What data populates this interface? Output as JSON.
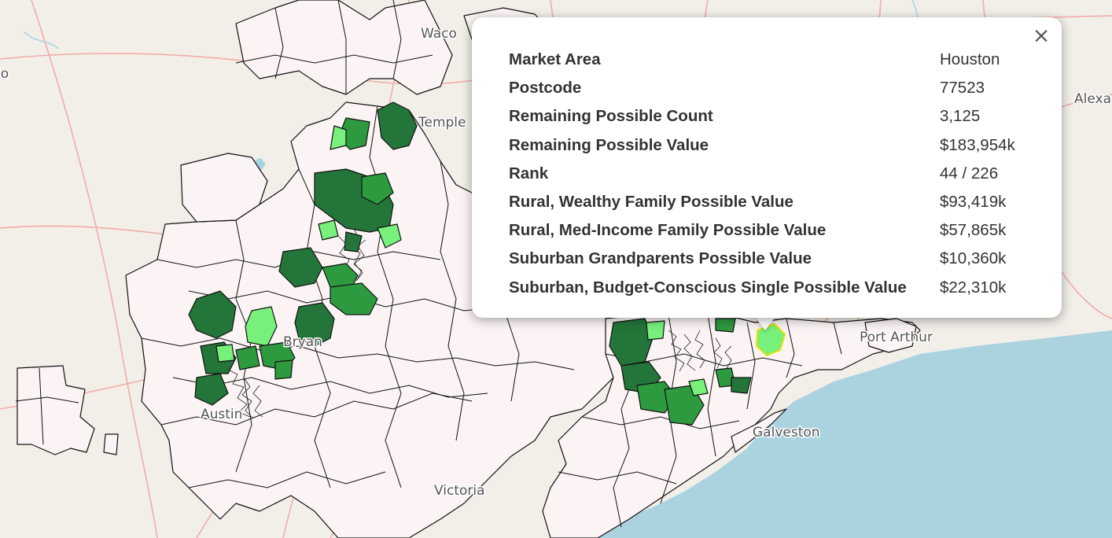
{
  "map": {
    "cities": [
      {
        "id": "temple",
        "name": "Temple"
      },
      {
        "id": "alexandria",
        "name": "Alexa"
      },
      {
        "id": "port-arthur",
        "name": "Port Arthur"
      },
      {
        "id": "galveston",
        "name": "Galveston"
      },
      {
        "id": "victoria",
        "name": "Victoria"
      },
      {
        "id": "bryan",
        "name": "Bryan"
      },
      {
        "id": "left-edge",
        "name": "lo"
      },
      {
        "id": "waco",
        "name": "Waco"
      },
      {
        "id": "austin",
        "name": "Austin"
      }
    ],
    "colors": {
      "water": "#aad3df",
      "land": "#f2efe9",
      "zone_base": "#fcf4f4",
      "zone_dark": "#23753a",
      "zone_mid": "#2e9a40",
      "zone_light": "#78f07c",
      "road": "#f2a4a0",
      "selected": "#e6e100"
    }
  },
  "popup": {
    "close_label": "×",
    "rows": [
      {
        "label": "Market Area",
        "value": "Houston"
      },
      {
        "label": "Postcode",
        "value": "77523"
      },
      {
        "label": "Remaining Possible Count",
        "value": "3,125"
      },
      {
        "label": "Remaining Possible Value",
        "value": "$183,954k"
      },
      {
        "label": "Rank",
        "value": "44 / 226"
      },
      {
        "label": "Rural, Wealthy Family Possible Value",
        "value": "$93,419k"
      },
      {
        "label": "Rural, Med-Income Family Possible Value",
        "value": "$57,865k"
      },
      {
        "label": "Suburban Grandparents Possible Value",
        "value": "$10,360k"
      },
      {
        "label": "Suburban, Budget-Conscious Single Possible Value",
        "value": "$22,310k"
      }
    ]
  }
}
